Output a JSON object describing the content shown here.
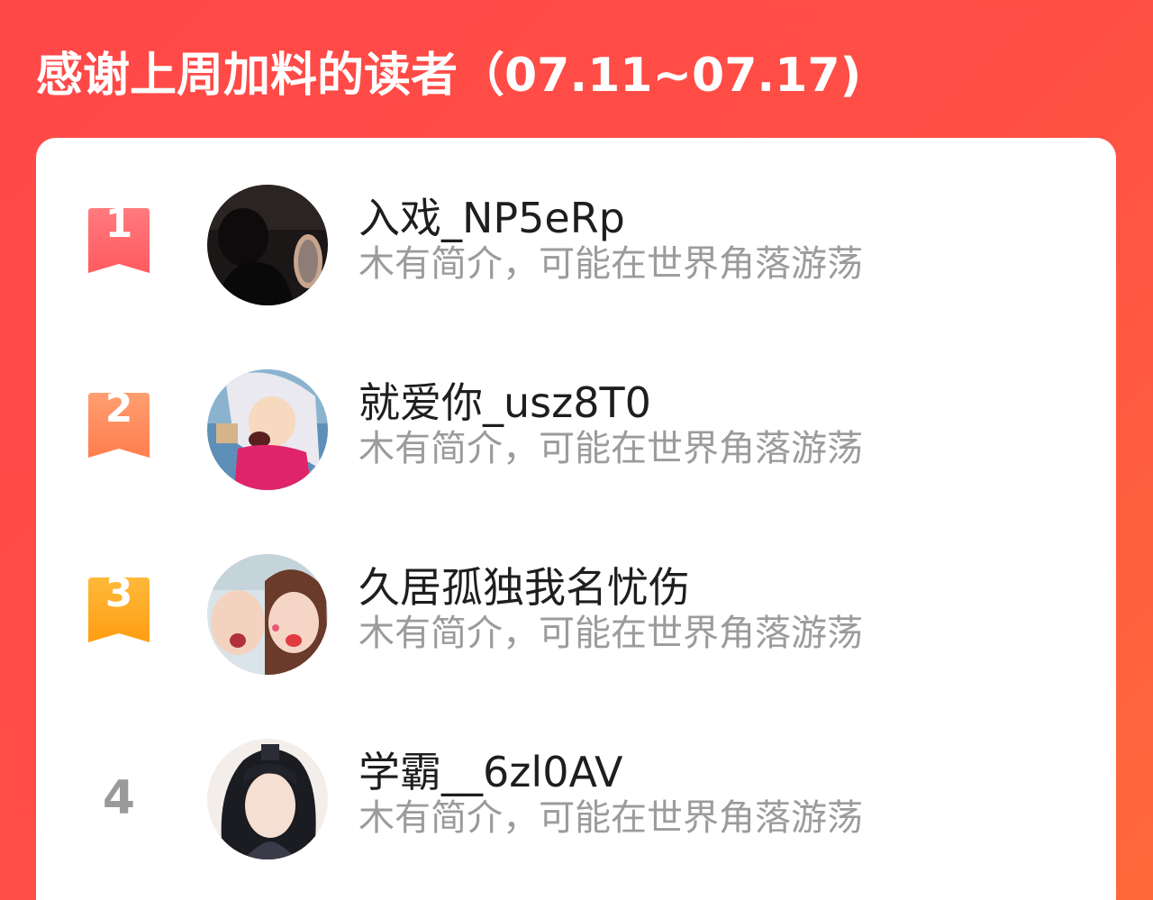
{
  "header": {
    "title": "感谢上周加料的读者（07.11~07.17)"
  },
  "colors": {
    "background_start": "#ff4848",
    "background_end": "#ff6a3a",
    "rank1": "#ff5a5f",
    "rank2": "#ff8a55",
    "rank3": "#ffa31a",
    "rank_plain": "#9a9a9a"
  },
  "readers": [
    {
      "rank": "1",
      "name": "入戏_NP5eRp",
      "bio": "木有简介，可能在世界角落游荡",
      "avatar": "dark-silhouette-avatar"
    },
    {
      "rank": "2",
      "name": "就爱你_usz8T0",
      "bio": "木有简介，可能在世界角落游荡",
      "avatar": "anime-character-avatar"
    },
    {
      "rank": "3",
      "name": "久居孤独我名忧伤",
      "bio": "木有简介，可能在世界角落游荡",
      "avatar": "selfie-photo-avatar"
    },
    {
      "rank": "4",
      "name": "学霸__6zl0AV",
      "bio": "木有简介，可能在世界角落游荡",
      "avatar": "illustrated-portrait-avatar"
    }
  ]
}
